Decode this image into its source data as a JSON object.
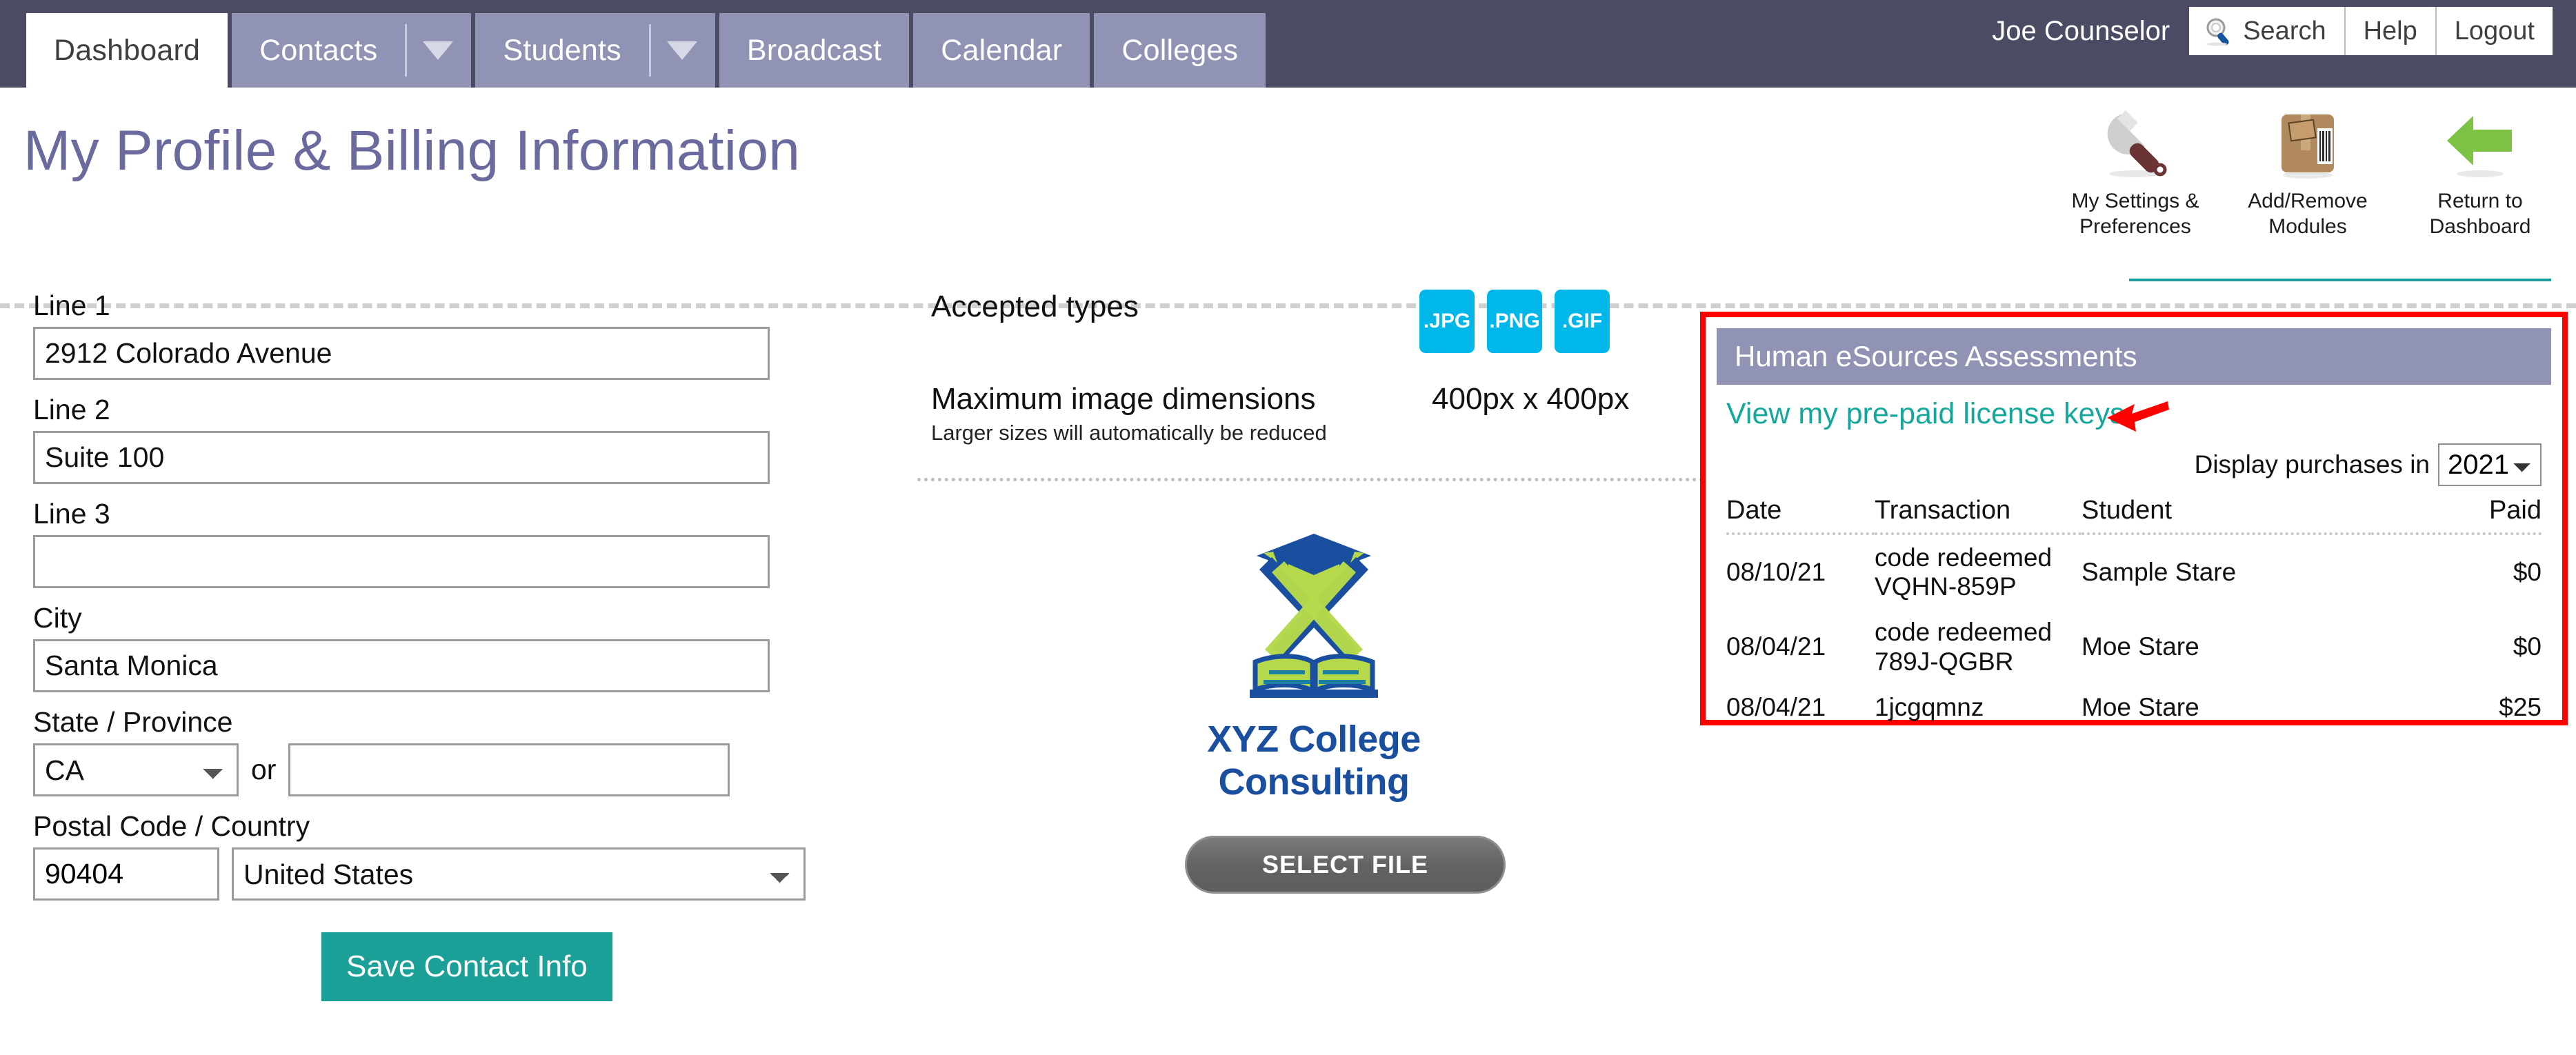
{
  "nav": {
    "tabs": [
      {
        "label": "Dashboard",
        "active": true,
        "caret": false
      },
      {
        "label": "Contacts",
        "active": false,
        "caret": true
      },
      {
        "label": "Students",
        "active": false,
        "caret": true
      },
      {
        "label": "Broadcast",
        "active": false,
        "caret": false
      },
      {
        "label": "Calendar",
        "active": false,
        "caret": false
      },
      {
        "label": "Colleges",
        "active": false,
        "caret": false
      }
    ],
    "username": "Joe Counselor",
    "search_label": "Search",
    "help_label": "Help",
    "logout_label": "Logout",
    "search_icon": "magnifier-icon"
  },
  "page": {
    "title": "My Profile & Billing Information"
  },
  "toolbar": {
    "items": [
      {
        "label_line1": "My Settings &",
        "label_line2": "Preferences",
        "icon": "wrench-icon"
      },
      {
        "label_line1": "Add/Remove",
        "label_line2": "Modules",
        "icon": "package-box-icon"
      },
      {
        "label_line1": "Return to",
        "label_line2": "Dashboard",
        "icon": "green-back-arrow-icon"
      }
    ]
  },
  "address_form": {
    "line1_label": "Line 1",
    "line1_value": "2912 Colorado Avenue",
    "line2_label": "Line 2",
    "line2_value": "Suite 100",
    "line3_label": "Line 3",
    "line3_value": "",
    "city_label": "City",
    "city_value": "Santa Monica",
    "state_label": "State / Province",
    "state_value": "CA",
    "state_options": [
      "CA"
    ],
    "or_label": "or",
    "state_free_value": "",
    "postal_label": "Postal Code / Country",
    "postal_value": "90404",
    "country_value": "United States",
    "country_options": [
      "United States"
    ],
    "save_label": "Save Contact Info"
  },
  "upload": {
    "accepted_types_label": "Accepted types",
    "types": [
      ".JPG",
      ".PNG",
      ".GIF"
    ],
    "max_dimensions_label": "Maximum image dimensions",
    "max_dimensions_note": "Larger sizes will automatically be reduced",
    "max_dimensions_value": "400px  x  400px",
    "logo_name": "XYZ College Consulting",
    "select_file_label": "SELECT FILE",
    "badge_color": "#00b7ea"
  },
  "assessments": {
    "panel_title": "Human eSources Assessments",
    "license_link": "View my pre-paid license keys",
    "arrow_icon": "red-left-arrow-icon",
    "display_label": "Display purchases in",
    "display_year": "2021",
    "year_options": [
      "2021"
    ],
    "highlight_color": "#fb0100",
    "columns": [
      "Date",
      "Transaction",
      "Student",
      "Paid"
    ],
    "rows": [
      {
        "date": "08/10/21",
        "transaction_line1": "code redeemed",
        "transaction_line2": "VQHN-859P",
        "student": "Sample Stare",
        "paid": "$0"
      },
      {
        "date": "08/04/21",
        "transaction_line1": "code redeemed",
        "transaction_line2": "789J-QGBR",
        "student": "Moe Stare",
        "paid": "$0"
      },
      {
        "date": "08/04/21",
        "transaction_line1": "1jcgqmnz",
        "transaction_line2": "",
        "student": "Moe Stare",
        "paid": "$25"
      }
    ]
  }
}
